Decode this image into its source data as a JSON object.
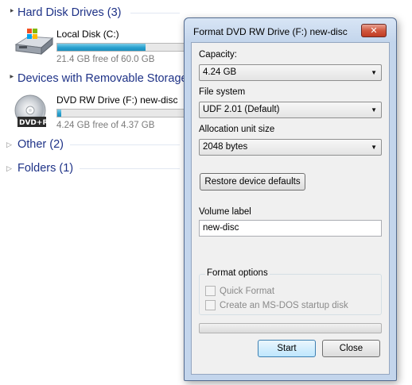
{
  "explorer": {
    "groups": {
      "hard_disks": {
        "label": "Hard Disk Drives (3)",
        "arrow": "▲"
      },
      "removable": {
        "label": "Devices with Removable Storage",
        "arrow": "▲"
      },
      "other": {
        "label": "Other (2)",
        "arrow": "▷"
      },
      "folders": {
        "label": "Folders (1)",
        "arrow": "▷"
      }
    },
    "drives": [
      {
        "name": "Local Disk (C:)",
        "free_text": "21.4 GB free of 60.0 GB",
        "used_fraction": 0.64,
        "icon": "hard-disk-icon"
      },
      {
        "name": "DVD RW Drive (F:) new-disc",
        "free_text": "4.24 GB free of 4.37 GB",
        "used_fraction": 0.03,
        "icon": "dvd-drive-icon",
        "badge": "DVD+R"
      }
    ]
  },
  "dialog": {
    "title": "Format DVD RW Drive (F:) new-disc",
    "close_glyph": "✕",
    "capacity": {
      "label": "Capacity:",
      "value": "4.24 GB"
    },
    "file_system": {
      "label": "File system",
      "value": "UDF 2.01 (Default)"
    },
    "allocation": {
      "label": "Allocation unit size",
      "value": "2048 bytes"
    },
    "restore_label": "Restore device defaults",
    "volume": {
      "label": "Volume label",
      "value": "new-disc"
    },
    "format_options": {
      "title": "Format options",
      "quick_format": "Quick Format",
      "msdos_disk": "Create an MS-DOS startup disk"
    },
    "progress": 0,
    "start_label": "Start",
    "close_label": "Close"
  },
  "colors": {
    "group_header": "#1e3287",
    "usage_bar": "#29a1cf",
    "close_button": "#c03b22",
    "dialog_frame": "#c3d5ec"
  }
}
